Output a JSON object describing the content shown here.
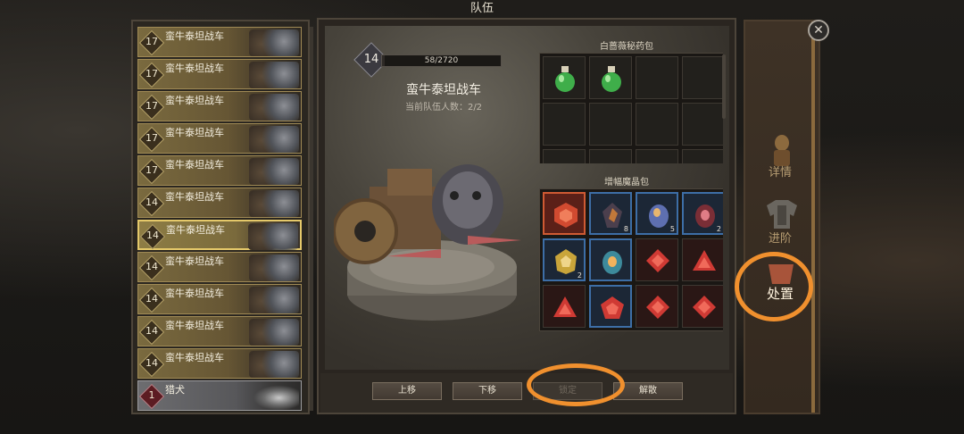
{
  "title": "队伍",
  "roster": [
    {
      "level": "17",
      "name": "蛮牛泰坦战车"
    },
    {
      "level": "17",
      "name": "蛮牛泰坦战车"
    },
    {
      "level": "17",
      "name": "蛮牛泰坦战车"
    },
    {
      "level": "17",
      "name": "蛮牛泰坦战车"
    },
    {
      "level": "17",
      "name": "蛮牛泰坦战车"
    },
    {
      "level": "14",
      "name": "蛮牛泰坦战车"
    },
    {
      "level": "14",
      "name": "蛮牛泰坦战车",
      "selected": true
    },
    {
      "level": "14",
      "name": "蛮牛泰坦战车"
    },
    {
      "level": "14",
      "name": "蛮牛泰坦战车"
    },
    {
      "level": "14",
      "name": "蛮牛泰坦战车"
    },
    {
      "level": "14",
      "name": "蛮牛泰坦战车"
    },
    {
      "level": "1",
      "name": "猎犬"
    }
  ],
  "unit": {
    "level": "14",
    "xp_text": "58/2720",
    "xp_fraction": 0.021,
    "name": "蛮牛泰坦战车",
    "team_count": "当前队伍人数：2/2"
  },
  "potion_bag": {
    "title": "白蔷薇秘药包",
    "slots": [
      "green-potion",
      "green-potion",
      "",
      "",
      "",
      "",
      "",
      "",
      "",
      "",
      "",
      ""
    ]
  },
  "crystal_bag": {
    "title": "增幅魔晶包",
    "slots": [
      {
        "icon": "red-hex-crystal-icon",
        "count": "",
        "style": "red"
      },
      {
        "icon": "dark-gem-icon",
        "count": "8",
        "style": "blue"
      },
      {
        "icon": "blue-gem-icon",
        "count": "5",
        "style": "blue"
      },
      {
        "icon": "red-gem-icon",
        "count": "2",
        "style": "blue"
      },
      {
        "icon": "yellow-gem-icon",
        "count": "2",
        "style": "blue"
      },
      {
        "icon": "teal-gem-icon",
        "count": "",
        "style": "blue"
      },
      {
        "icon": "red-diamond-icon",
        "count": "",
        "style": "redglow"
      },
      {
        "icon": "red-triangle-icon",
        "count": "",
        "style": "redglow"
      },
      {
        "icon": "red-triangle-icon",
        "count": "",
        "style": "redglow"
      },
      {
        "icon": "red-pentagon-icon",
        "count": "",
        "style": "blue"
      },
      {
        "icon": "red-diamond-icon",
        "count": "",
        "style": "redglow"
      },
      {
        "icon": "red-diamond-icon",
        "count": "",
        "style": "redglow"
      }
    ]
  },
  "buttons": {
    "move_up": "上移",
    "move_down": "下移",
    "lock": "锁定",
    "disband": "解散"
  },
  "tabs": {
    "details": "详情",
    "advance": "进阶",
    "manage": "处置"
  },
  "colors": {
    "highlight_ring": "#f0902e",
    "selected_border": "#e5c96a"
  }
}
